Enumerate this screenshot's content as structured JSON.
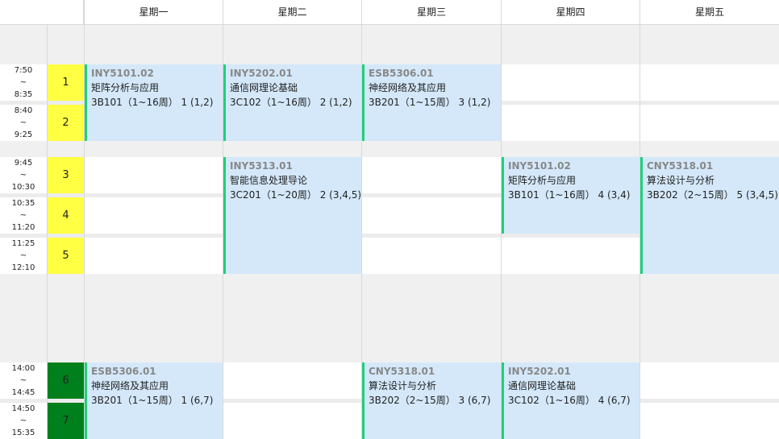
{
  "days": [
    "星期一",
    "星期二",
    "星期三",
    "星期四",
    "星期五"
  ],
  "periods": [
    {
      "num": "1",
      "start": "7:50",
      "tilde": "~",
      "end": "8:35",
      "color": "#ffff44"
    },
    {
      "num": "2",
      "start": "8:40",
      "tilde": "~",
      "end": "9:25",
      "color": "#ffff44"
    },
    {
      "num": "3",
      "start": "9:45",
      "tilde": "~",
      "end": "10:30",
      "color": "#ffff44"
    },
    {
      "num": "4",
      "start": "10:35",
      "tilde": "~",
      "end": "11:20",
      "color": "#ffff44"
    },
    {
      "num": "5",
      "start": "11:25",
      "tilde": "~",
      "end": "12:10",
      "color": "#ffff44"
    },
    {
      "num": "6",
      "start": "14:00",
      "tilde": "~",
      "end": "14:45",
      "color": "#007f1d"
    },
    {
      "num": "7",
      "start": "14:50",
      "tilde": "~",
      "end": "15:35",
      "color": "#007f1d"
    }
  ],
  "courses": [
    {
      "code": "INY5101.02",
      "name": "矩阵分析与应用",
      "detail": "3B101（1~16周） 1 (1,2)"
    },
    {
      "code": "INY5202.01",
      "name": "通信网理论基础",
      "detail": "3C102（1~16周） 2 (1,2)"
    },
    {
      "code": "ESB5306.01",
      "name": "神经网络及其应用",
      "detail": "3B201（1~15周） 3 (1,2)"
    },
    {
      "code": "INY5313.01",
      "name": "智能信息处理导论",
      "detail": "3C201（1~20周） 2 (3,4,5)"
    },
    {
      "code": "INY5101.02",
      "name": "矩阵分析与应用",
      "detail": "3B101（1~16周） 4 (3,4)"
    },
    {
      "code": "CNY5318.01",
      "name": "算法设计与分析",
      "detail": "3B202（2~15周） 5 (3,4,5)"
    },
    {
      "code": "ESB5306.01",
      "name": "神经网络及其应用",
      "detail": "3B201（1~15周） 1 (6,7)"
    },
    {
      "code": "CNY5318.01",
      "name": "算法设计与分析",
      "detail": "3B202（2~15周） 3 (6,7)"
    },
    {
      "code": "INY5202.01",
      "name": "通信网理论基础",
      "detail": "3C102（1~16周） 4 (6,7)"
    }
  ],
  "colors": {
    "course_bg": "#d4e8fa",
    "course_border": "#1fcf7a",
    "morning_num": "#ffff44",
    "afternoon_num": "#007f1d",
    "break_band": "#f0f0f0"
  }
}
